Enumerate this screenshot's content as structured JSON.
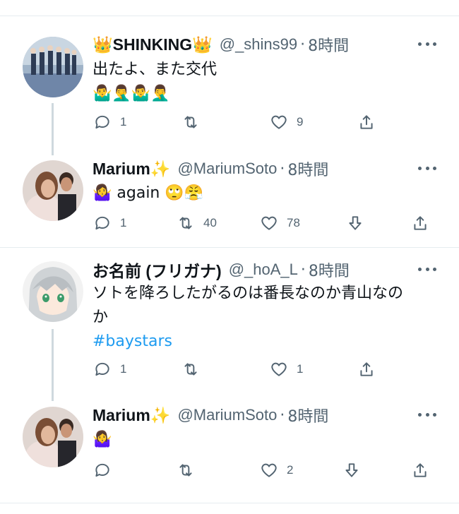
{
  "tweets": [
    {
      "name": "👑SHINKING👑",
      "handle": "@_shins99",
      "dot": "·",
      "time": "8時間",
      "text_line1": "出たよ、また交代",
      "text_line2": "🤷‍♂️🤦‍♂️🤷‍♂️🤦‍♂️",
      "reply_count": "1",
      "retweet_count": "",
      "like_count": "9"
    },
    {
      "name": "Marium✨",
      "handle": "@MariumSoto",
      "dot": "·",
      "time": "8時間",
      "text_line1": "🤷‍♀️ again 🙄😤",
      "reply_count": "1",
      "retweet_count": "40",
      "like_count": "78"
    },
    {
      "name": "お名前 (フリガナ)",
      "handle": "@_hoA_L",
      "dot": "·",
      "time": "8時間",
      "text_line1": "ソトを降ろしたがるのは番長なのか青山なの",
      "text_line2": "か",
      "hashtag": "#baystars",
      "reply_count": "1",
      "retweet_count": "",
      "like_count": "1"
    },
    {
      "name": "Marium✨",
      "handle": "@MariumSoto",
      "dot": "·",
      "time": "8時間",
      "text_line1": "🤷‍♀️",
      "reply_count": "",
      "retweet_count": "",
      "like_count": "2"
    }
  ],
  "colors": {
    "accent": "#1d9bf0",
    "muted": "#536471",
    "text": "#0f1419",
    "divider": "#e6ecf0"
  }
}
